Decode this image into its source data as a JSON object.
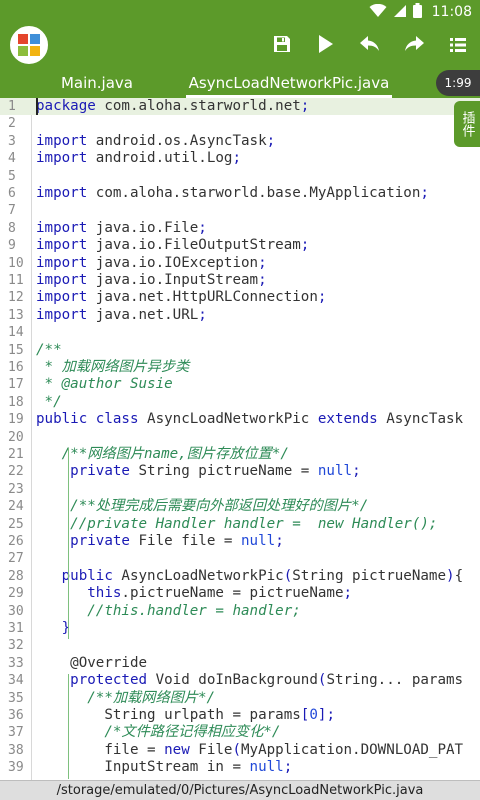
{
  "status_bar": {
    "time": "11:08"
  },
  "icons": {
    "wifi": "wifi-icon",
    "signal": "signal-icon",
    "battery": "battery-icon",
    "save": "save-icon",
    "run": "play-icon",
    "undo": "undo-icon",
    "redo": "redo-icon",
    "menu": "list-menu-icon"
  },
  "colors": {
    "accent": "#5c9a2a",
    "keyword": "#1a1ab5",
    "comment": "#2e8b57",
    "line_number": "#8a8a8a"
  },
  "tabs": [
    {
      "label": "Main.java"
    },
    {
      "label": "AsyncLoadNetworkPic.java"
    }
  ],
  "line_counter": "1:99",
  "plugin_label": "插件",
  "path": "/storage/emulated/0/Pictures/AsyncLoadNetworkPic.java",
  "code_lines": [
    {
      "n": "1",
      "tokens": [
        [
          "kw",
          "package"
        ],
        [
          "pl",
          " com.aloha.starworld.net"
        ],
        [
          "str",
          ";"
        ]
      ]
    },
    {
      "n": "2",
      "tokens": []
    },
    {
      "n": "3",
      "tokens": [
        [
          "kw",
          "import"
        ],
        [
          "pl",
          " android.os.AsyncTask"
        ],
        [
          "str",
          ";"
        ]
      ]
    },
    {
      "n": "4",
      "tokens": [
        [
          "kw",
          "import"
        ],
        [
          "pl",
          " android.util.Log"
        ],
        [
          "str",
          ";"
        ]
      ]
    },
    {
      "n": "5",
      "tokens": []
    },
    {
      "n": "6",
      "tokens": [
        [
          "kw",
          "import"
        ],
        [
          "pl",
          " com.aloha.starworld.base.MyApplication"
        ],
        [
          "str",
          ";"
        ]
      ]
    },
    {
      "n": "7",
      "tokens": []
    },
    {
      "n": "8",
      "tokens": [
        [
          "kw",
          "import"
        ],
        [
          "pl",
          " java.io.File"
        ],
        [
          "str",
          ";"
        ]
      ]
    },
    {
      "n": "9",
      "tokens": [
        [
          "kw",
          "import"
        ],
        [
          "pl",
          " java.io.FileOutputStream"
        ],
        [
          "str",
          ";"
        ]
      ]
    },
    {
      "n": "10",
      "tokens": [
        [
          "kw",
          "import"
        ],
        [
          "pl",
          " java.io.IOException"
        ],
        [
          "str",
          ";"
        ]
      ]
    },
    {
      "n": "11",
      "tokens": [
        [
          "kw",
          "import"
        ],
        [
          "pl",
          " java.io.InputStream"
        ],
        [
          "str",
          ";"
        ]
      ]
    },
    {
      "n": "12",
      "tokens": [
        [
          "kw",
          "import"
        ],
        [
          "pl",
          " java.net.HttpURLConnection"
        ],
        [
          "str",
          ";"
        ]
      ]
    },
    {
      "n": "13",
      "tokens": [
        [
          "kw",
          "import"
        ],
        [
          "pl",
          " java.net.URL"
        ],
        [
          "str",
          ";"
        ]
      ]
    },
    {
      "n": "14",
      "tokens": []
    },
    {
      "n": "15",
      "tokens": [
        [
          "cm",
          "/**"
        ]
      ]
    },
    {
      "n": "16",
      "tokens": [
        [
          "cm",
          " * 加载网络图片异步类"
        ]
      ]
    },
    {
      "n": "17",
      "tokens": [
        [
          "cm",
          " * @author Susie"
        ]
      ]
    },
    {
      "n": "18",
      "tokens": [
        [
          "cm",
          " */"
        ]
      ]
    },
    {
      "n": "19",
      "tokens": [
        [
          "kw",
          "public class"
        ],
        [
          "pl",
          " AsyncLoadNetworkPic "
        ],
        [
          "kw",
          "extends"
        ],
        [
          "pl",
          " AsyncTask"
        ]
      ]
    },
    {
      "n": "20",
      "tokens": []
    },
    {
      "n": "21",
      "tokens": [
        [
          "pl",
          "   "
        ],
        [
          "cm",
          "/**网络图片name,图片存放位置*/"
        ]
      ]
    },
    {
      "n": "22",
      "tokens": [
        [
          "pl",
          "    "
        ],
        [
          "kw",
          "private"
        ],
        [
          "pl",
          " String pictrueName = "
        ],
        [
          "lit",
          "null"
        ],
        [
          "str",
          ";"
        ]
      ]
    },
    {
      "n": "23",
      "tokens": []
    },
    {
      "n": "24",
      "tokens": [
        [
          "pl",
          "    "
        ],
        [
          "cm",
          "/**处理完成后需要向外部返回处理好的图片*/"
        ]
      ]
    },
    {
      "n": "25",
      "tokens": [
        [
          "pl",
          "    "
        ],
        [
          "cm",
          "//private Handler handler =  new Handler();"
        ]
      ]
    },
    {
      "n": "26",
      "tokens": [
        [
          "pl",
          "    "
        ],
        [
          "kw",
          "private"
        ],
        [
          "pl",
          " File file = "
        ],
        [
          "lit",
          "null"
        ],
        [
          "str",
          ";"
        ]
      ]
    },
    {
      "n": "27",
      "tokens": []
    },
    {
      "n": "28",
      "tokens": [
        [
          "pl",
          "   "
        ],
        [
          "kw",
          "public"
        ],
        [
          "pl",
          " AsyncLoadNetworkPic"
        ],
        [
          "str",
          "("
        ],
        [
          "pl",
          "String pictrueName"
        ],
        [
          "str",
          ")"
        ],
        [
          "pl",
          "{"
        ]
      ]
    },
    {
      "n": "29",
      "tokens": [
        [
          "pl",
          "      "
        ],
        [
          "kw",
          "this"
        ],
        [
          "pl",
          ".pictrueName = pictrueName"
        ],
        [
          "str",
          ";"
        ]
      ]
    },
    {
      "n": "30",
      "tokens": [
        [
          "pl",
          "      "
        ],
        [
          "cm",
          "//this.handler = handler;"
        ]
      ]
    },
    {
      "n": "31",
      "tokens": [
        [
          "pl",
          "   "
        ],
        [
          "str",
          "}"
        ]
      ]
    },
    {
      "n": "32",
      "tokens": []
    },
    {
      "n": "33",
      "tokens": [
        [
          "pl",
          "    "
        ],
        [
          "an",
          "@Override"
        ]
      ]
    },
    {
      "n": "34",
      "tokens": [
        [
          "pl",
          "    "
        ],
        [
          "kw",
          "protected"
        ],
        [
          "pl",
          " Void doInBackground"
        ],
        [
          "str",
          "("
        ],
        [
          "pl",
          "String... params"
        ]
      ]
    },
    {
      "n": "35",
      "tokens": [
        [
          "pl",
          "      "
        ],
        [
          "cm",
          "/**加载网络图片*/"
        ]
      ]
    },
    {
      "n": "36",
      "tokens": [
        [
          "pl",
          "        String urlpath = params"
        ],
        [
          "str",
          "["
        ],
        [
          "lit",
          "0"
        ],
        [
          "str",
          "]"
        ],
        [
          "str",
          ";"
        ]
      ]
    },
    {
      "n": "37",
      "tokens": [
        [
          "pl",
          "        "
        ],
        [
          "cm",
          "/*文件路径记得相应变化*/"
        ]
      ]
    },
    {
      "n": "38",
      "tokens": [
        [
          "pl",
          "        file = "
        ],
        [
          "kw",
          "new"
        ],
        [
          "pl",
          " File"
        ],
        [
          "str",
          "("
        ],
        [
          "pl",
          "MyApplication.DOWNLOAD_PAT"
        ]
      ]
    },
    {
      "n": "39",
      "tokens": [
        [
          "pl",
          "        InputStream in = "
        ],
        [
          "lit",
          "null"
        ],
        [
          "str",
          ";"
        ]
      ]
    }
  ]
}
